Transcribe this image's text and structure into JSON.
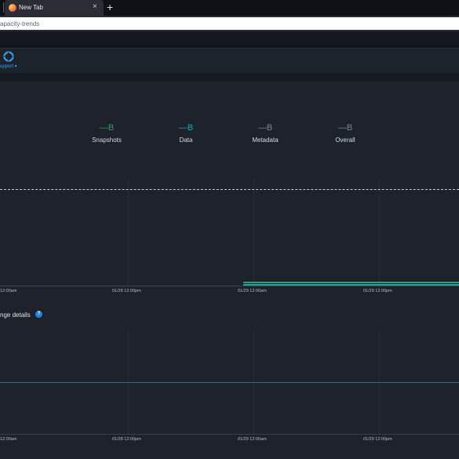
{
  "browser": {
    "tab_title": "New Tab",
    "tab_close": "×",
    "new_tab": "+",
    "url": "apacity-trends"
  },
  "header": {
    "support_label": "upport ▾"
  },
  "legend": [
    {
      "value": "—B",
      "name": "Snapshots",
      "color": "#2e9f6a"
    },
    {
      "value": "—B",
      "name": "Data",
      "color": "#1aa3a3"
    },
    {
      "value": "—B",
      "name": "Metadata",
      "color": "#7c8796"
    },
    {
      "value": "—B",
      "name": "Overall",
      "color": "#7c8796"
    }
  ],
  "chart_top": {
    "x_ticks": [
      "12:00am",
      "01/28 12:00pm",
      "01/29 12:00am",
      "01/29 12:00pm"
    ]
  },
  "section": {
    "title": "nge details",
    "help_icon": "?"
  },
  "chart_bottom": {
    "x_ticks": [
      "12:00am",
      "01/28 12:00pm",
      "01/29 12:00am",
      "01/29 12:00pm"
    ]
  },
  "colors": {
    "accent": "#3a9bf0",
    "background": "#1d222b",
    "snapshots": "#2e9f6a",
    "data": "#1aa3a3"
  }
}
